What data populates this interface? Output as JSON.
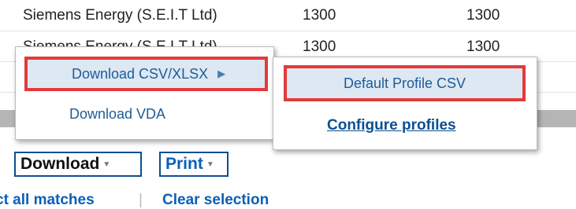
{
  "table": {
    "rows": [
      {
        "name": "Siemens Energy (S.E.I.T Ltd)",
        "v1": "1300",
        "v2": "1300"
      },
      {
        "name": "Siemens Energy (S.E.I.T Ltd)",
        "v1": "1300",
        "v2": "1300"
      },
      {
        "name": "",
        "v1": "",
        "v2": ""
      }
    ]
  },
  "menu": {
    "download_csv": "Download CSV/XLSX",
    "download_vda": "Download VDA",
    "submenu": {
      "default_profile": "Default Profile CSV",
      "configure": "Configure profiles"
    }
  },
  "toolbar": {
    "download_label": "Download",
    "print_label": "Print"
  },
  "links": {
    "select_all": "ct all matches",
    "separator": "|",
    "clear": "Clear selection"
  },
  "colors": {
    "link": "#0b5fb8",
    "highlight_border": "#e23a3a",
    "highlight_bg": "#dde8f3"
  }
}
